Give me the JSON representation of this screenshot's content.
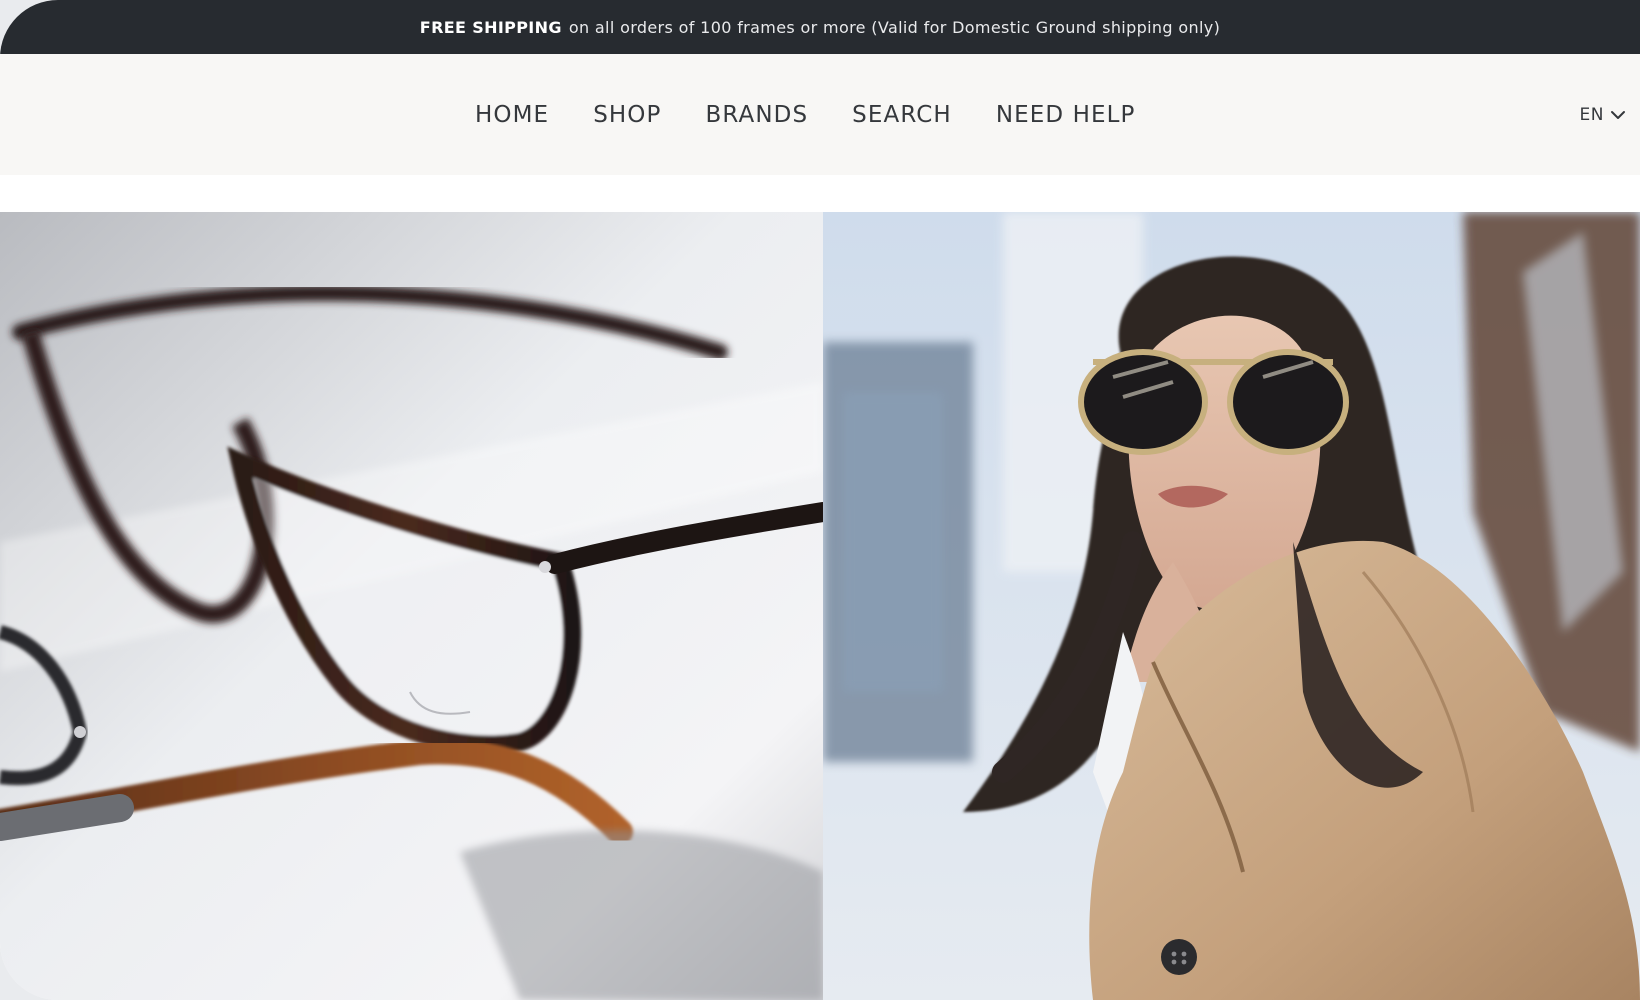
{
  "announcement": {
    "bold": "FREE SHIPPING",
    "text": "on all orders of 100 frames or more (Valid for Domestic Ground shipping only)"
  },
  "nav": {
    "items": [
      {
        "label": "HOME"
      },
      {
        "label": "SHOP"
      },
      {
        "label": "BRANDS"
      },
      {
        "label": "SEARCH"
      },
      {
        "label": "NEED HELP"
      }
    ]
  },
  "language": {
    "label": "EN",
    "icon": "chevron-down-icon"
  },
  "hero": {
    "left_image": "eyeglasses-product-photo",
    "right_image": "woman-wearing-sunglasses-photo"
  },
  "colors": {
    "announcement_bg": "#272b30",
    "header_bg": "#f8f7f5",
    "nav_text": "#35383c"
  }
}
